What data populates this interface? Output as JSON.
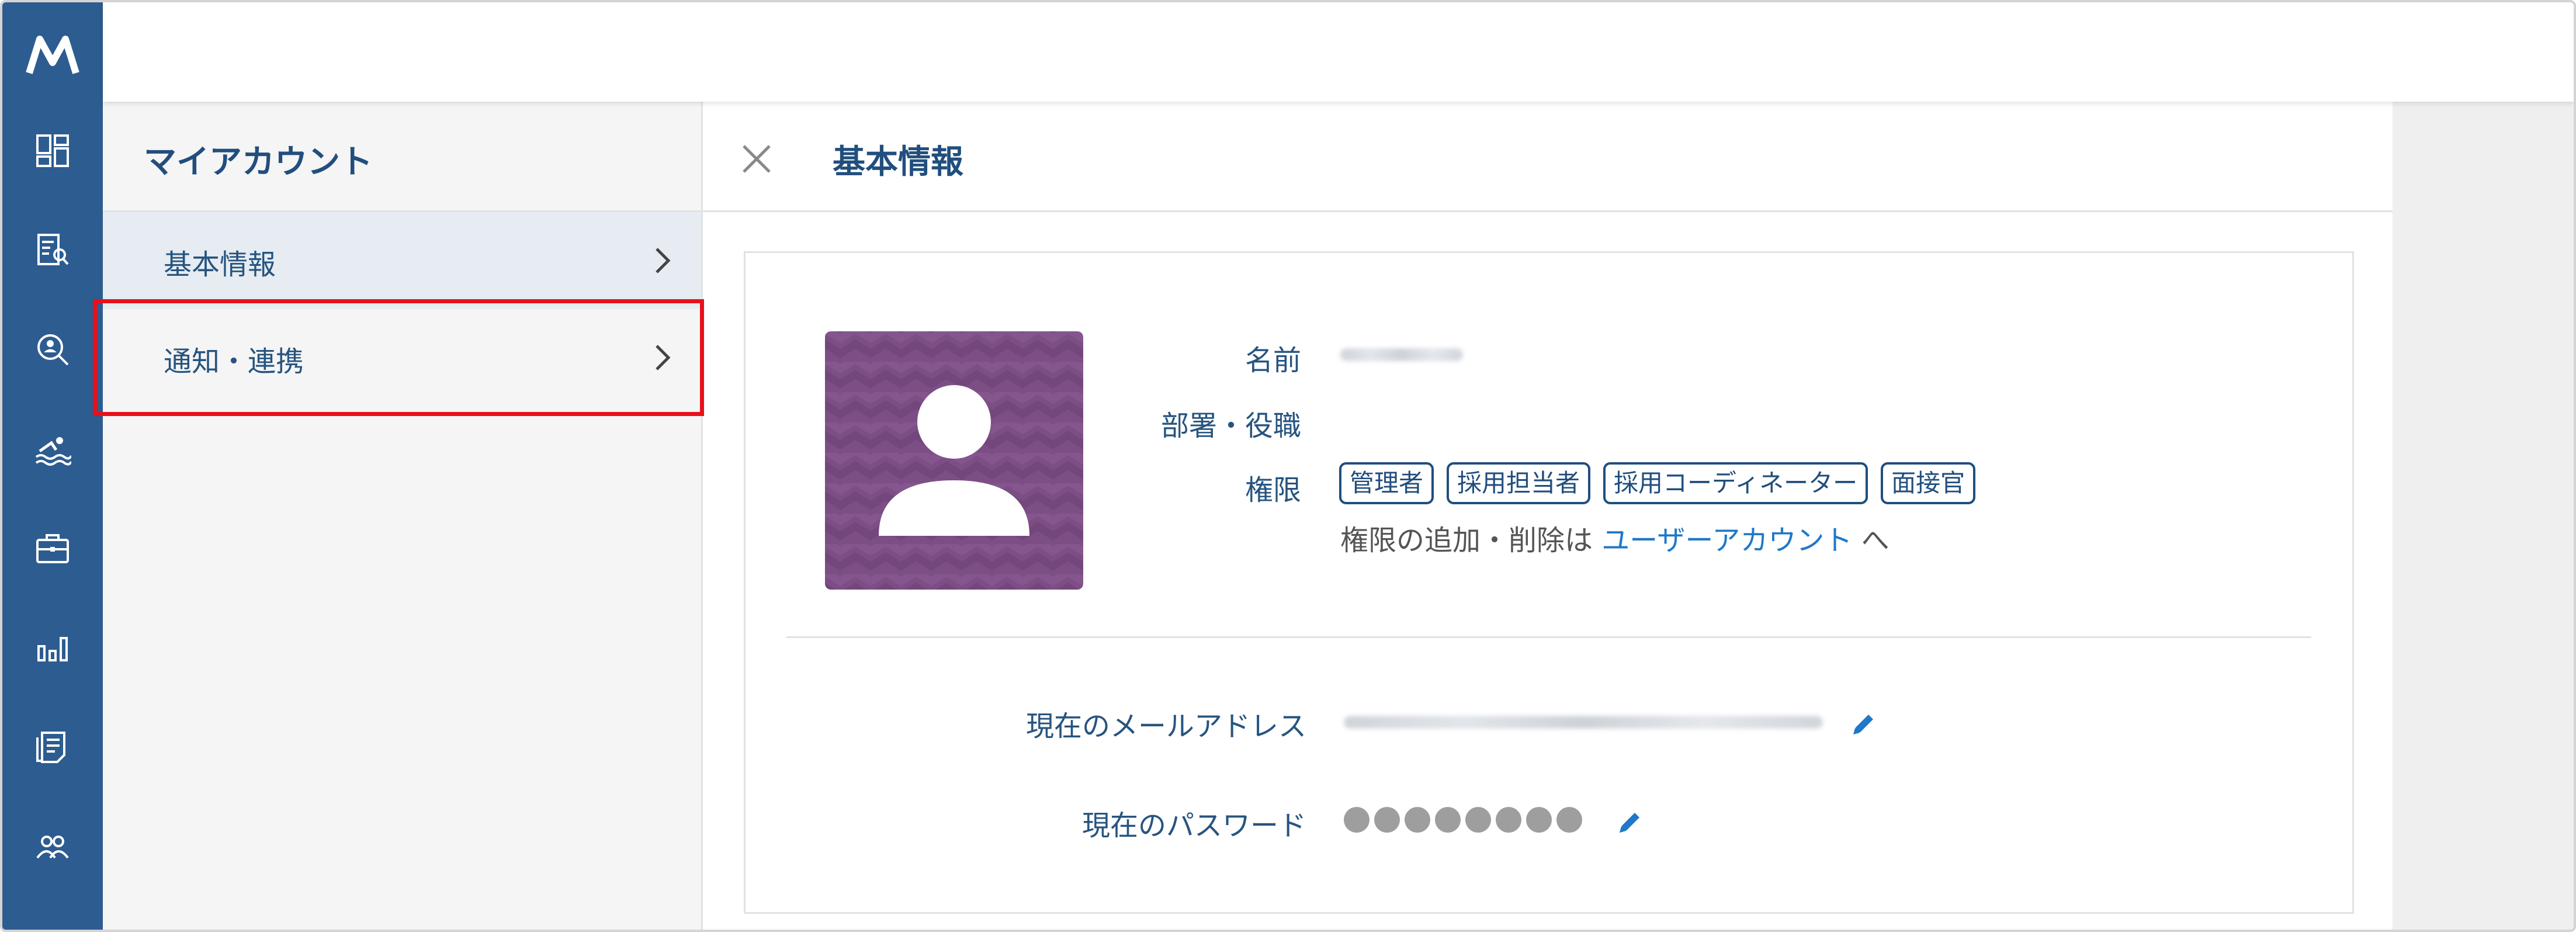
{
  "sidebar": {
    "icons": [
      "logo-icon",
      "dashboard-icon",
      "report-search-icon",
      "candidate-search-icon",
      "swimmer-icon",
      "briefcase-icon",
      "bar-chart-icon",
      "document-icon",
      "users-icon"
    ]
  },
  "subnav": {
    "title": "マイアカウント",
    "items": [
      {
        "label": "基本情報",
        "active": true
      },
      {
        "label": "通知・連携",
        "active": false
      }
    ]
  },
  "panel": {
    "title": "基本情報",
    "fields": {
      "name_label": "名前",
      "department_label": "部署・役職",
      "permissions_label": "権限",
      "email_label": "現在のメールアドレス",
      "password_label": "現在のパスワード"
    },
    "permissions": [
      "管理者",
      "採用担当者",
      "採用コーディネーター",
      "面接官"
    ],
    "note_prefix": "権限の追加・削除は",
    "note_link": "ユーザーアカウント",
    "note_suffix": "へ",
    "password_dots": 8
  },
  "colors": {
    "rail": "#2d5c90",
    "accent_text": "#214e7d",
    "link": "#1f78c9",
    "highlight": "#e8101a",
    "avatar_bg": "#7d4e86"
  }
}
